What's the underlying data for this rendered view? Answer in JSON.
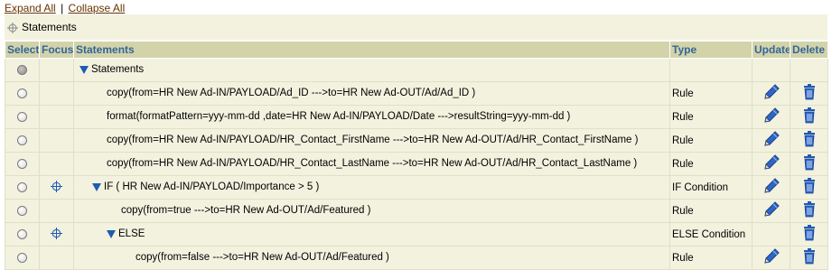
{
  "header": {
    "expand_all": "Expand All",
    "separator": "|",
    "collapse_all": "Collapse All",
    "breadcrumb": "Statements"
  },
  "columns": {
    "select": "Select",
    "focus": "Focus",
    "statements": "Statements",
    "type": "Type",
    "update": "Update",
    "delete": "Delete"
  },
  "rows": [
    {
      "text": "Statements",
      "type": "",
      "selected": true,
      "focus": false,
      "expander": true,
      "update": false,
      "delete": false
    },
    {
      "text": "copy(from=HR New Ad-IN/PAYLOAD/Ad_ID --->to=HR New Ad-OUT/Ad/Ad_ID )",
      "type": "Rule",
      "selected": false,
      "focus": false,
      "expander": false,
      "update": true,
      "delete": true
    },
    {
      "text": "format(formatPattern=yyy-mm-dd ,date=HR New Ad-IN/PAYLOAD/Date --->resultString=yyy-mm-dd )",
      "type": "Rule",
      "selected": false,
      "focus": false,
      "expander": false,
      "update": true,
      "delete": true
    },
    {
      "text": "copy(from=HR New Ad-IN/PAYLOAD/HR_Contact_FirstName --->to=HR New Ad-OUT/Ad/HR_Contact_FirstName )",
      "type": "Rule",
      "selected": false,
      "focus": false,
      "expander": false,
      "update": true,
      "delete": true
    },
    {
      "text": "copy(from=HR New Ad-IN/PAYLOAD/HR_Contact_LastName --->to=HR New Ad-OUT/Ad/HR_Contact_LastName )",
      "type": "Rule",
      "selected": false,
      "focus": false,
      "expander": false,
      "update": true,
      "delete": true
    },
    {
      "text": "IF ( HR New Ad-IN/PAYLOAD/Importance > 5 )",
      "type": "IF Condition",
      "selected": false,
      "focus": true,
      "expander": true,
      "update": true,
      "delete": true
    },
    {
      "text": "copy(from=true --->to=HR New Ad-OUT/Ad/Featured )",
      "type": "Rule",
      "selected": false,
      "focus": false,
      "expander": false,
      "update": true,
      "delete": true
    },
    {
      "text": "ELSE",
      "type": "ELSE Condition",
      "selected": false,
      "focus": true,
      "expander": true,
      "update": false,
      "delete": true
    },
    {
      "text": "copy(from=false --->to=HR New Ad-OUT/Ad/Featured )",
      "type": "Rule",
      "selected": false,
      "focus": false,
      "expander": false,
      "update": true,
      "delete": true
    }
  ],
  "icons": {
    "focus": "focus-crosshair-icon",
    "expander": "expand-triangle-icon",
    "update": "pencil-icon",
    "delete": "trash-icon"
  },
  "colors": {
    "header_bg": "#d3d3aa",
    "header_text": "#336699",
    "row_bg": "#f2f2df",
    "link": "#663300",
    "icon_blue": "#1e5ab4"
  }
}
